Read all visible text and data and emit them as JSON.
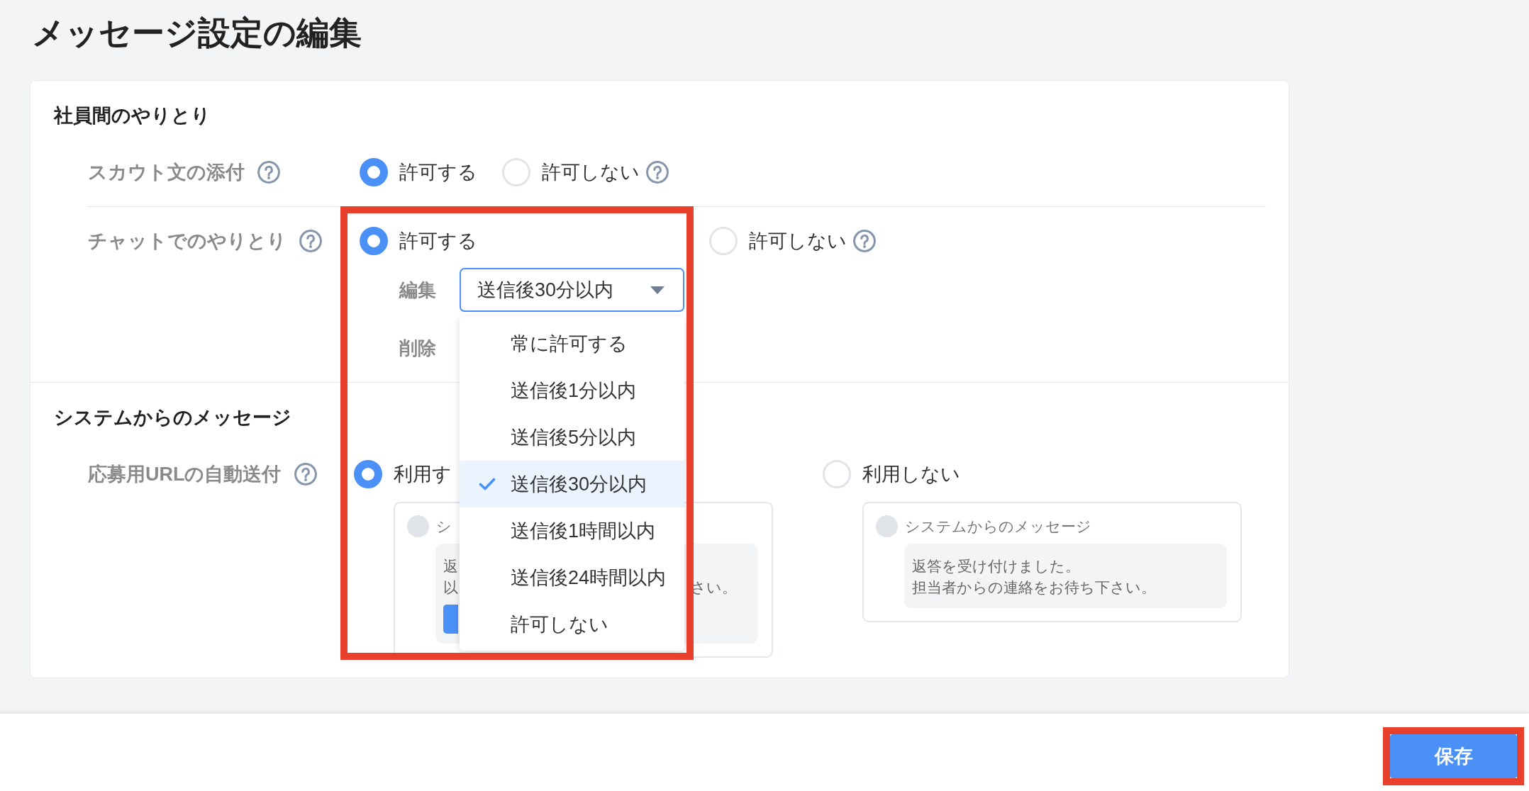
{
  "page": {
    "title": "メッセージ設定の編集"
  },
  "sections": [
    {
      "heading": "社員間のやりとり",
      "rows": [
        {
          "label": "スカウト文の添付",
          "help": true,
          "options": [
            {
              "label": "許可する",
              "selected": true,
              "help": false,
              "highlighted": false
            },
            {
              "label": "許可しない",
              "selected": false,
              "help": true,
              "highlighted": false
            }
          ]
        },
        {
          "label": "チャットでのやりとり",
          "help": true,
          "options": [
            {
              "label": "許可する",
              "selected": true,
              "help": false,
              "highlighted": true,
              "settings": [
                {
                  "label": "編集",
                  "select": {
                    "value": "送信後30分以内",
                    "open": true,
                    "options": [
                      {
                        "label": "常に許可する",
                        "selected": false
                      },
                      {
                        "label": "送信後1分以内",
                        "selected": false
                      },
                      {
                        "label": "送信後5分以内",
                        "selected": false
                      },
                      {
                        "label": "送信後30分以内",
                        "selected": true
                      },
                      {
                        "label": "送信後1時間以内",
                        "selected": false
                      },
                      {
                        "label": "送信後24時間以内",
                        "selected": false
                      },
                      {
                        "label": "許可しない",
                        "selected": false
                      }
                    ]
                  }
                },
                {
                  "label": "削除"
                }
              ]
            },
            {
              "label": "許可しない",
              "selected": false,
              "help": true,
              "highlighted": false
            }
          ]
        }
      ]
    },
    {
      "heading": "システムからのメッセージ",
      "rows": [
        {
          "label": "応募用URLの自動送付",
          "help": true,
          "options": [
            {
              "label": "利用す",
              "selected": true,
              "help": false,
              "highlighted": false,
              "preview": {
                "sender": "シ",
                "lines": [
                  [
                    "返"
                  ],
                  [
                    "以",
                    "さい。"
                  ]
                ],
                "button": true
              }
            },
            {
              "label": "利用しない",
              "selected": false,
              "help": false,
              "highlighted": false,
              "preview": {
                "sender": "システムからのメッセージ",
                "lines": [
                  [
                    "返答を受け付けました。"
                  ],
                  [
                    "担当者からの連絡をお待ち下さい。"
                  ]
                ],
                "button": false
              }
            }
          ]
        }
      ]
    }
  ],
  "footer": {
    "save_button": {
      "label": "保存",
      "highlighted": true
    }
  }
}
